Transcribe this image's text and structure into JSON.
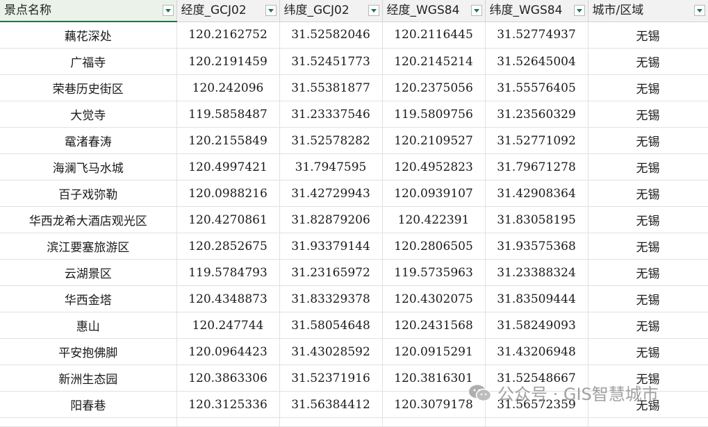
{
  "headers": [
    "景点名称",
    "经度_GCJ02",
    "纬度_GCJ02",
    "经度_WGS84",
    "纬度_WGS84",
    "城市/区域"
  ],
  "rows": [
    [
      "藕花深处",
      "120.2162752",
      "31.52582046",
      "120.2116445",
      "31.52774937",
      "无锡"
    ],
    [
      "广福寺",
      "120.2191459",
      "31.52451773",
      "120.2145214",
      "31.52645004",
      "无锡"
    ],
    [
      "荣巷历史街区",
      "120.242096",
      "31.55381877",
      "120.2375056",
      "31.55576405",
      "无锡"
    ],
    [
      "大觉寺",
      "119.5858487",
      "31.23337546",
      "119.5809756",
      "31.23560329",
      "无锡"
    ],
    [
      "鼋渚春涛",
      "120.2155849",
      "31.52578282",
      "120.2109527",
      "31.52771092",
      "无锡"
    ],
    [
      "海澜飞马水城",
      "120.4997421",
      "31.7947595",
      "120.4952823",
      "31.79671278",
      "无锡"
    ],
    [
      "百子戏弥勒",
      "120.0988216",
      "31.42729943",
      "120.0939107",
      "31.42908364",
      "无锡"
    ],
    [
      "华西龙希大酒店观光区",
      "120.4270861",
      "31.82879206",
      "120.422391",
      "31.83058195",
      "无锡"
    ],
    [
      "滨江要塞旅游区",
      "120.2852675",
      "31.93379144",
      "120.2806505",
      "31.93575368",
      "无锡"
    ],
    [
      "云湖景区",
      "119.5784793",
      "31.23165972",
      "119.5735963",
      "31.23388324",
      "无锡"
    ],
    [
      "华西金塔",
      "120.4348873",
      "31.83329378",
      "120.4302075",
      "31.83509444",
      "无锡"
    ],
    [
      "惠山",
      "120.247744",
      "31.58054648",
      "120.2431568",
      "31.58249093",
      "无锡"
    ],
    [
      "平安抱佛脚",
      "120.0964423",
      "31.43028592",
      "120.0915291",
      "31.43206948",
      "无锡"
    ],
    [
      "新洲生态园",
      "120.3863306",
      "31.52371916",
      "120.3816301",
      "31.52548667",
      "无锡"
    ],
    [
      "阳春巷",
      "120.3125336",
      "31.56384412",
      "120.3079178",
      "31.56572359",
      "无锡"
    ]
  ],
  "watermark": {
    "text": "公众号 · GIS智慧城市",
    "icon": "wechat-icon"
  },
  "colors": {
    "header_bg": "#f2f2f2",
    "selected_header_bg": "#eaf2ea",
    "accent": "#217346",
    "grid": "#e1e1e1"
  }
}
